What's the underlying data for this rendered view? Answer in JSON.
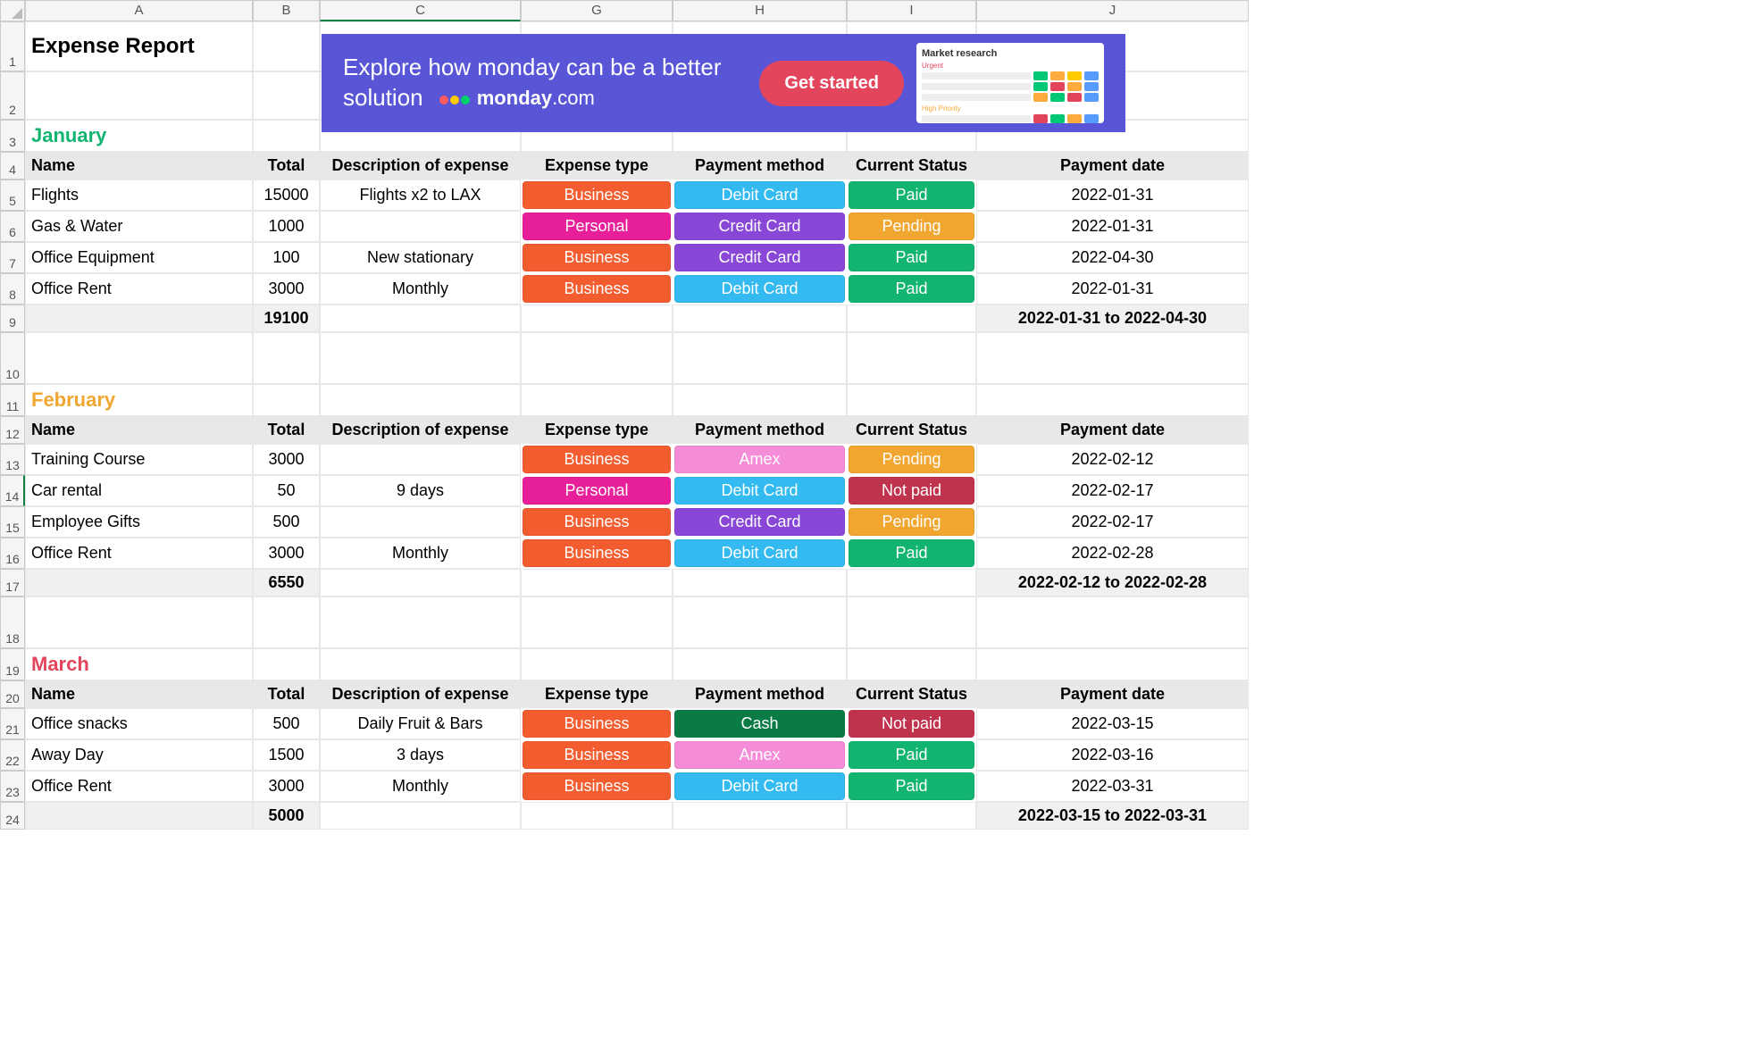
{
  "title": "Expense Report",
  "columns": [
    "A",
    "B",
    "C",
    "G",
    "H",
    "I",
    "J"
  ],
  "row_numbers": [
    "1",
    "2",
    "3",
    "4",
    "5",
    "6",
    "7",
    "8",
    "9",
    "10",
    "11",
    "12",
    "13",
    "14",
    "15",
    "16",
    "17",
    "18",
    "19",
    "20",
    "21",
    "22",
    "23",
    "24"
  ],
  "headers": {
    "name": "Name",
    "total": "Total",
    "description": "Description of expense",
    "expense_type": "Expense type",
    "payment_method": "Payment method",
    "current_status": "Current Status",
    "payment_date": "Payment date"
  },
  "months": [
    {
      "label": "January",
      "css": "m-jan",
      "rows": [
        {
          "name": "Flights",
          "total": "15000",
          "desc": "Flights x2 to LAX",
          "type": "Business",
          "type_c": "c-business",
          "pay": "Debit Card",
          "pay_c": "c-debit",
          "status": "Paid",
          "status_c": "c-paid",
          "date": "2022-01-31"
        },
        {
          "name": "Gas & Water",
          "total": "1000",
          "desc": "",
          "type": "Personal",
          "type_c": "c-personal",
          "pay": "Credit Card",
          "pay_c": "c-credit",
          "status": "Pending",
          "status_c": "c-pending",
          "date": "2022-01-31"
        },
        {
          "name": "Office Equipment",
          "total": "100",
          "desc": "New stationary",
          "type": "Business",
          "type_c": "c-business",
          "pay": "Credit Card",
          "pay_c": "c-credit",
          "status": "Paid",
          "status_c": "c-paid",
          "date": "2022-04-30"
        },
        {
          "name": "Office Rent",
          "total": "3000",
          "desc": "Monthly",
          "type": "Business",
          "type_c": "c-business",
          "pay": "Debit Card",
          "pay_c": "c-debit",
          "status": "Paid",
          "status_c": "c-paid",
          "date": "2022-01-31"
        }
      ],
      "sum": "19100",
      "range": "2022-01-31 to 2022-04-30"
    },
    {
      "label": "February",
      "css": "m-feb",
      "rows": [
        {
          "name": "Training Course",
          "total": "3000",
          "desc": "",
          "type": "Business",
          "type_c": "c-business",
          "pay": "Amex",
          "pay_c": "c-amex",
          "status": "Pending",
          "status_c": "c-pending",
          "date": "2022-02-12"
        },
        {
          "name": "Car rental",
          "total": "50",
          "desc": "9 days",
          "type": "Personal",
          "type_c": "c-personal",
          "pay": "Debit Card",
          "pay_c": "c-debit",
          "status": "Not paid",
          "status_c": "c-notpaid",
          "date": "2022-02-17"
        },
        {
          "name": "Employee Gifts",
          "total": "500",
          "desc": "",
          "type": "Business",
          "type_c": "c-business",
          "pay": "Credit Card",
          "pay_c": "c-credit",
          "status": "Pending",
          "status_c": "c-pending",
          "date": "2022-02-17"
        },
        {
          "name": "Office Rent",
          "total": "3000",
          "desc": "Monthly",
          "type": "Business",
          "type_c": "c-business",
          "pay": "Debit Card",
          "pay_c": "c-debit",
          "status": "Paid",
          "status_c": "c-paid",
          "date": "2022-02-28"
        }
      ],
      "sum": "6550",
      "range": "2022-02-12 to 2022-02-28"
    },
    {
      "label": "March",
      "css": "m-mar",
      "rows": [
        {
          "name": "Office snacks",
          "total": "500",
          "desc": "Daily Fruit & Bars",
          "type": "Business",
          "type_c": "c-business",
          "pay": "Cash",
          "pay_c": "c-cash",
          "status": "Not paid",
          "status_c": "c-notpaid",
          "date": "2022-03-15"
        },
        {
          "name": "Away Day",
          "total": "1500",
          "desc": "3 days",
          "type": "Business",
          "type_c": "c-business",
          "pay": "Amex",
          "pay_c": "c-amex",
          "status": "Paid",
          "status_c": "c-paid",
          "date": "2022-03-16"
        },
        {
          "name": "Office Rent",
          "total": "3000",
          "desc": "Monthly",
          "type": "Business",
          "type_c": "c-business",
          "pay": "Debit Card",
          "pay_c": "c-debit",
          "status": "Paid",
          "status_c": "c-paid",
          "date": "2022-03-31"
        }
      ],
      "sum": "5000",
      "range": "2022-03-15 to 2022-03-31"
    }
  ],
  "banner": {
    "line1": "Explore how monday can be a better",
    "line2": "solution",
    "brand": "monday",
    "brand_suffix": ".com",
    "cta": "Get started",
    "mini_title": "Market research",
    "mini_sub1": "Urgent",
    "mini_sub2": "High Priority"
  },
  "active_cell": {
    "col": "C",
    "row": "14"
  }
}
